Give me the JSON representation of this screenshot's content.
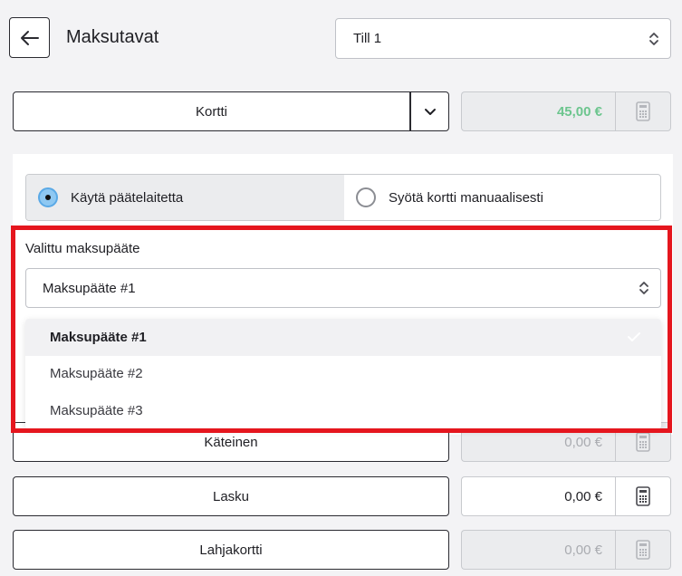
{
  "header": {
    "title": "Maksutavat",
    "till_select": "Till 1"
  },
  "payment_methods": [
    {
      "label": "Kortti",
      "amount": "45,00 €"
    },
    {
      "label": "Käteinen",
      "amount": "0,00 €"
    },
    {
      "label": "Lasku",
      "amount": "0,00 €"
    },
    {
      "label": "Lahjakortti",
      "amount": "0,00 €"
    }
  ],
  "card_options": {
    "use_terminal": "Käytä päätelaitetta",
    "manual_entry": "Syötä kortti manuaalisesti"
  },
  "terminal": {
    "label": "Valittu maksupääte",
    "selected": "Maksupääte #1",
    "options": [
      "Maksupääte #1",
      "Maksupääte #2",
      "Maksupääte #3"
    ]
  },
  "colors": {
    "highlight": "#e5161e",
    "amount_green": "#6cc58e",
    "radio_active": "#8ec8f2"
  }
}
